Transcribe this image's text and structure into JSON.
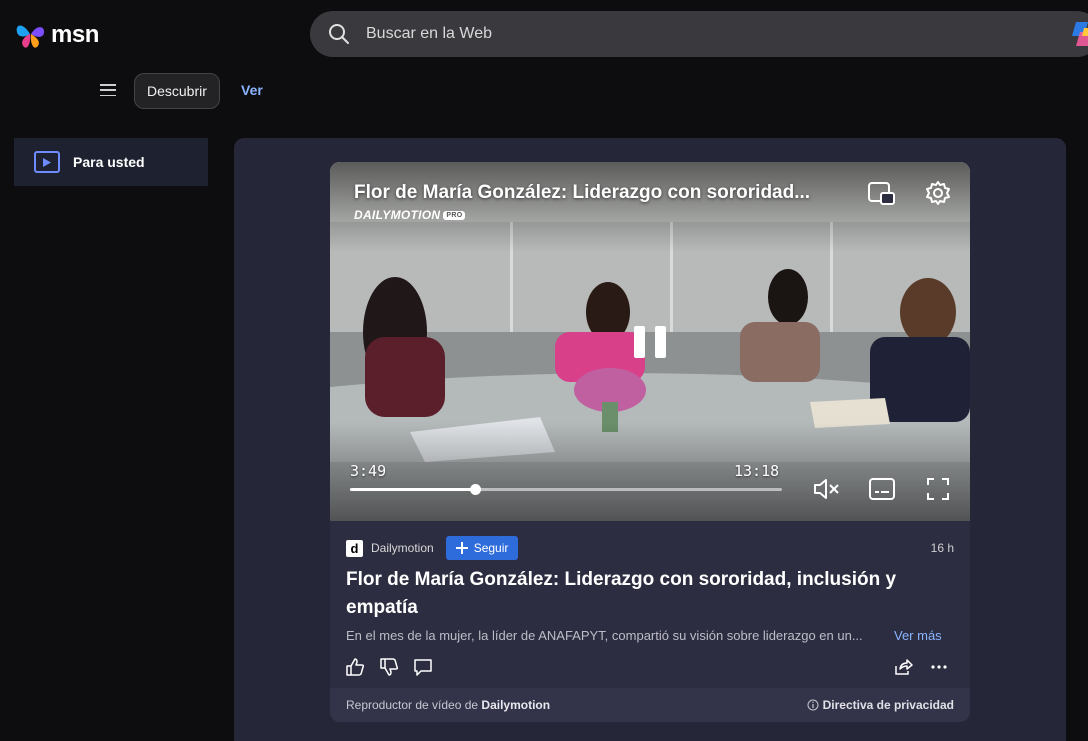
{
  "header": {
    "logo_text": "msn",
    "search_placeholder": "Buscar en la Web"
  },
  "subnav": {
    "menu_icon": "hamburger-icon",
    "discover_label": "Descubrir",
    "watch_label": "Ver"
  },
  "sidebar": {
    "items": [
      {
        "label": "Para usted",
        "icon": "play-icon",
        "active": true
      }
    ]
  },
  "video": {
    "title": "Flor de María González: Liderazgo con sororidad...",
    "brand": "DAILYMOTION",
    "brand_badge": "PRO",
    "current_time": "3:49",
    "duration": "13:18",
    "progress_fraction": 0.29,
    "state": "playing",
    "muted": true
  },
  "article": {
    "provider": "Dailymotion",
    "provider_logo_letter": "d",
    "follow_label": "Seguir",
    "age": "16 h",
    "headline": "Flor de María González: Liderazgo con sororidad, inclusión y empatía",
    "summary": "En el mes de la mujer, la líder de ANAFAPYT, compartió su visión sobre liderazgo en un...",
    "more_label": "Ver más"
  },
  "footer": {
    "player_prefix": "Reproductor de vídeo de ",
    "player_name": "Dailymotion",
    "privacy_label": "Directiva de privacidad"
  },
  "colors": {
    "background": "#0d0d0f",
    "panel": "#252637",
    "card": "#2c2d40",
    "accent": "#2f6cdb",
    "link": "#8ab4ff"
  }
}
